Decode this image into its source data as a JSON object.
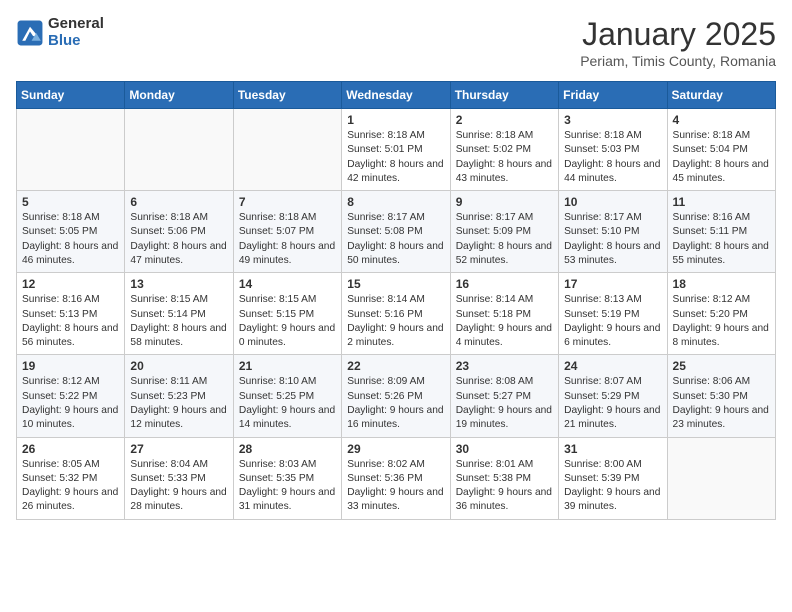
{
  "header": {
    "logo_general": "General",
    "logo_blue": "Blue",
    "month": "January 2025",
    "location": "Periam, Timis County, Romania"
  },
  "days_of_week": [
    "Sunday",
    "Monday",
    "Tuesday",
    "Wednesday",
    "Thursday",
    "Friday",
    "Saturday"
  ],
  "weeks": [
    [
      {
        "day": "",
        "info": ""
      },
      {
        "day": "",
        "info": ""
      },
      {
        "day": "",
        "info": ""
      },
      {
        "day": "1",
        "info": "Sunrise: 8:18 AM\nSunset: 5:01 PM\nDaylight: 8 hours and 42 minutes."
      },
      {
        "day": "2",
        "info": "Sunrise: 8:18 AM\nSunset: 5:02 PM\nDaylight: 8 hours and 43 minutes."
      },
      {
        "day": "3",
        "info": "Sunrise: 8:18 AM\nSunset: 5:03 PM\nDaylight: 8 hours and 44 minutes."
      },
      {
        "day": "4",
        "info": "Sunrise: 8:18 AM\nSunset: 5:04 PM\nDaylight: 8 hours and 45 minutes."
      }
    ],
    [
      {
        "day": "5",
        "info": "Sunrise: 8:18 AM\nSunset: 5:05 PM\nDaylight: 8 hours and 46 minutes."
      },
      {
        "day": "6",
        "info": "Sunrise: 8:18 AM\nSunset: 5:06 PM\nDaylight: 8 hours and 47 minutes."
      },
      {
        "day": "7",
        "info": "Sunrise: 8:18 AM\nSunset: 5:07 PM\nDaylight: 8 hours and 49 minutes."
      },
      {
        "day": "8",
        "info": "Sunrise: 8:17 AM\nSunset: 5:08 PM\nDaylight: 8 hours and 50 minutes."
      },
      {
        "day": "9",
        "info": "Sunrise: 8:17 AM\nSunset: 5:09 PM\nDaylight: 8 hours and 52 minutes."
      },
      {
        "day": "10",
        "info": "Sunrise: 8:17 AM\nSunset: 5:10 PM\nDaylight: 8 hours and 53 minutes."
      },
      {
        "day": "11",
        "info": "Sunrise: 8:16 AM\nSunset: 5:11 PM\nDaylight: 8 hours and 55 minutes."
      }
    ],
    [
      {
        "day": "12",
        "info": "Sunrise: 8:16 AM\nSunset: 5:13 PM\nDaylight: 8 hours and 56 minutes."
      },
      {
        "day": "13",
        "info": "Sunrise: 8:15 AM\nSunset: 5:14 PM\nDaylight: 8 hours and 58 minutes."
      },
      {
        "day": "14",
        "info": "Sunrise: 8:15 AM\nSunset: 5:15 PM\nDaylight: 9 hours and 0 minutes."
      },
      {
        "day": "15",
        "info": "Sunrise: 8:14 AM\nSunset: 5:16 PM\nDaylight: 9 hours and 2 minutes."
      },
      {
        "day": "16",
        "info": "Sunrise: 8:14 AM\nSunset: 5:18 PM\nDaylight: 9 hours and 4 minutes."
      },
      {
        "day": "17",
        "info": "Sunrise: 8:13 AM\nSunset: 5:19 PM\nDaylight: 9 hours and 6 minutes."
      },
      {
        "day": "18",
        "info": "Sunrise: 8:12 AM\nSunset: 5:20 PM\nDaylight: 9 hours and 8 minutes."
      }
    ],
    [
      {
        "day": "19",
        "info": "Sunrise: 8:12 AM\nSunset: 5:22 PM\nDaylight: 9 hours and 10 minutes."
      },
      {
        "day": "20",
        "info": "Sunrise: 8:11 AM\nSunset: 5:23 PM\nDaylight: 9 hours and 12 minutes."
      },
      {
        "day": "21",
        "info": "Sunrise: 8:10 AM\nSunset: 5:25 PM\nDaylight: 9 hours and 14 minutes."
      },
      {
        "day": "22",
        "info": "Sunrise: 8:09 AM\nSunset: 5:26 PM\nDaylight: 9 hours and 16 minutes."
      },
      {
        "day": "23",
        "info": "Sunrise: 8:08 AM\nSunset: 5:27 PM\nDaylight: 9 hours and 19 minutes."
      },
      {
        "day": "24",
        "info": "Sunrise: 8:07 AM\nSunset: 5:29 PM\nDaylight: 9 hours and 21 minutes."
      },
      {
        "day": "25",
        "info": "Sunrise: 8:06 AM\nSunset: 5:30 PM\nDaylight: 9 hours and 23 minutes."
      }
    ],
    [
      {
        "day": "26",
        "info": "Sunrise: 8:05 AM\nSunset: 5:32 PM\nDaylight: 9 hours and 26 minutes."
      },
      {
        "day": "27",
        "info": "Sunrise: 8:04 AM\nSunset: 5:33 PM\nDaylight: 9 hours and 28 minutes."
      },
      {
        "day": "28",
        "info": "Sunrise: 8:03 AM\nSunset: 5:35 PM\nDaylight: 9 hours and 31 minutes."
      },
      {
        "day": "29",
        "info": "Sunrise: 8:02 AM\nSunset: 5:36 PM\nDaylight: 9 hours and 33 minutes."
      },
      {
        "day": "30",
        "info": "Sunrise: 8:01 AM\nSunset: 5:38 PM\nDaylight: 9 hours and 36 minutes."
      },
      {
        "day": "31",
        "info": "Sunrise: 8:00 AM\nSunset: 5:39 PM\nDaylight: 9 hours and 39 minutes."
      },
      {
        "day": "",
        "info": ""
      }
    ]
  ]
}
